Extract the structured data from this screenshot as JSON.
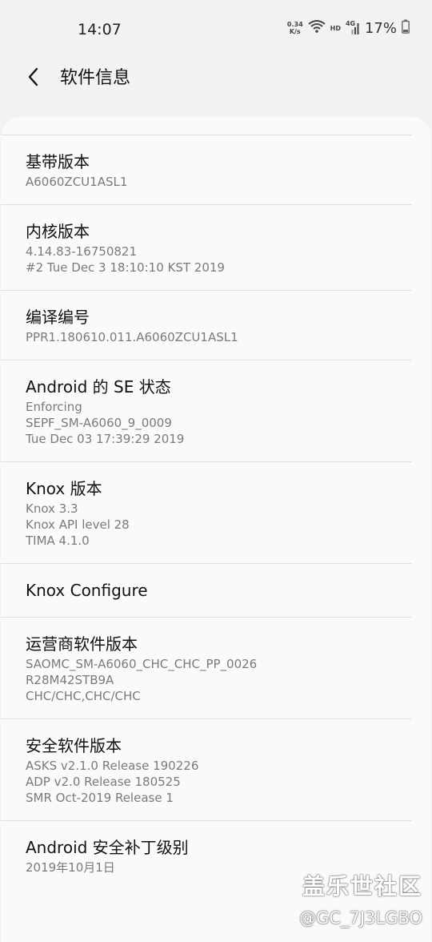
{
  "status_bar": {
    "time": "14:07",
    "net_speed_value": "0.34",
    "net_speed_unit": "K/s",
    "hd_label": "HD",
    "network_label": "4G",
    "battery_percent": "17%"
  },
  "app_bar": {
    "title": "软件信息"
  },
  "items": [
    {
      "title": "基带版本",
      "lines": [
        "A6060ZCU1ASL1"
      ]
    },
    {
      "title": "内核版本",
      "lines": [
        "4.14.83-16750821",
        "#2 Tue Dec 3 18:10:10 KST 2019"
      ]
    },
    {
      "title": "编译编号",
      "lines": [
        "PPR1.180610.011.A6060ZCU1ASL1"
      ]
    },
    {
      "title": "Android 的 SE 状态",
      "lines": [
        "Enforcing",
        "SEPF_SM-A6060_9_0009",
        "Tue Dec 03 17:39:29 2019"
      ]
    },
    {
      "title": "Knox 版本",
      "lines": [
        "Knox 3.3",
        "Knox API level 28",
        "TIMA 4.1.0"
      ]
    },
    {
      "title": "Knox Configure",
      "lines": []
    },
    {
      "title": "运营商软件版本",
      "lines": [
        "SAOMC_SM-A6060_CHC_CHC_PP_0026",
        "R28M42STB9A",
        "CHC/CHC,CHC/CHC"
      ]
    },
    {
      "title": "安全软件版本",
      "lines": [
        "ASKS v2.1.0 Release 190226",
        "ADP v2.0 Release 180525",
        "SMR Oct-2019 Release 1"
      ]
    },
    {
      "title": "Android 安全补丁级别",
      "lines": [
        "2019年10月1日"
      ]
    }
  ],
  "watermark": {
    "main": "盖乐世社区",
    "sub": "@GC_7J3LGBO"
  }
}
